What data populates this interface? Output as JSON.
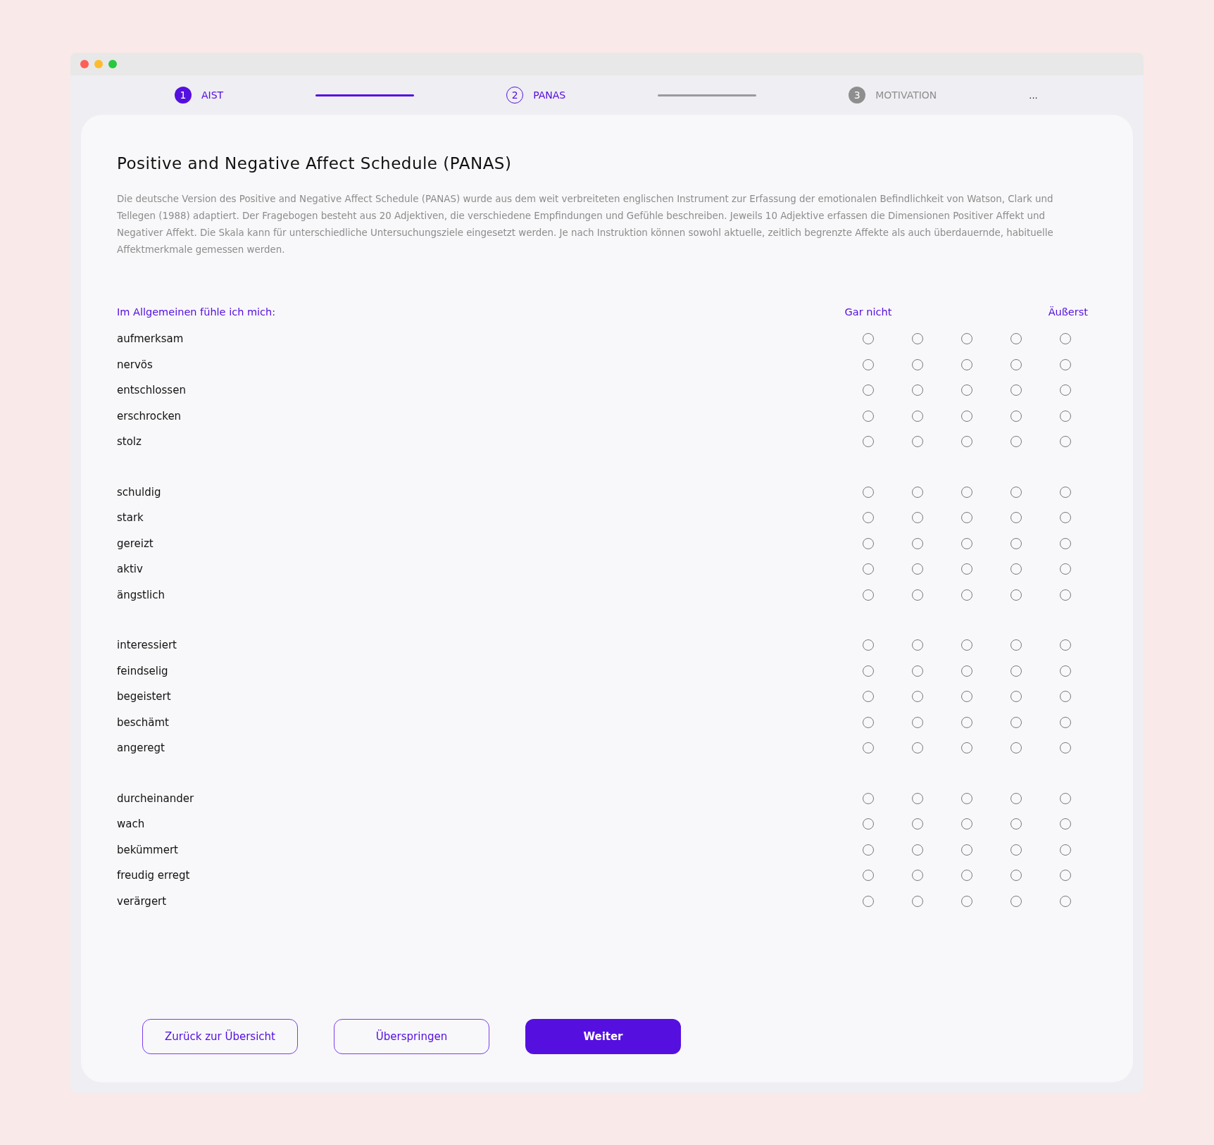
{
  "window": {
    "controls": [
      {
        "kind": "close"
      },
      {
        "kind": "minimize"
      },
      {
        "kind": "zoom"
      }
    ]
  },
  "steps": [
    {
      "number": "1",
      "label": "AIST",
      "done": true,
      "selected": false
    },
    {
      "number": "2",
      "label": "PANAS",
      "done": false,
      "selected": true
    },
    {
      "number": "3",
      "label": "MOTIVATION",
      "done": false,
      "selected": false
    }
  ],
  "more_steps": "...",
  "title": "Positive and Negative Affect Schedule (PANAS)",
  "description": "Die deutsche Version des Positive and Negative Affect Schedule (PANAS) wurde aus dem weit verbreiteten englischen Instrument zur Erfassung der emotionalen Befindlichkeit von Watson, Clark und Tellegen (1988) adaptiert. Der Fragebogen besteht aus 20 Adjektiven, die verschiedene Empfindungen und Gefühle beschreiben. Jeweils 10 Adjektive erfassen die Dimensionen Positiver Affekt und Negativer Affekt. Die Skala kann für unterschiedliche Untersuchungsziele eingesetzt werden. Je nach Instruktion können sowohl aktuelle, zeitlich begrenzte Affekte als auch überdauernde, habituelle Affektmerkmale gemessen werden.",
  "scale": {
    "prompt": "Im Allgemeinen fühle ich mich:",
    "low_label": "Gar nicht",
    "high_label": "Äußerst"
  },
  "groups": [
    {
      "items": [
        {
          "label": "aufmerksam",
          "options": [
            {
              "selected": false
            },
            {
              "selected": false
            },
            {
              "selected": false
            },
            {
              "selected": false
            },
            {
              "selected": false
            }
          ]
        },
        {
          "label": "nervös",
          "options": [
            {
              "selected": false
            },
            {
              "selected": false
            },
            {
              "selected": false
            },
            {
              "selected": false
            },
            {
              "selected": false
            }
          ]
        },
        {
          "label": "entschlossen",
          "options": [
            {
              "selected": false
            },
            {
              "selected": false
            },
            {
              "selected": false
            },
            {
              "selected": false
            },
            {
              "selected": false
            }
          ]
        },
        {
          "label": "erschrocken",
          "options": [
            {
              "selected": false
            },
            {
              "selected": false
            },
            {
              "selected": false
            },
            {
              "selected": false
            },
            {
              "selected": false
            }
          ]
        },
        {
          "label": "stolz",
          "options": [
            {
              "selected": false
            },
            {
              "selected": false
            },
            {
              "selected": false
            },
            {
              "selected": false
            },
            {
              "selected": false
            }
          ]
        }
      ]
    },
    {
      "items": [
        {
          "label": "schuldig",
          "options": [
            {
              "selected": false
            },
            {
              "selected": false
            },
            {
              "selected": false
            },
            {
              "selected": false
            },
            {
              "selected": false
            }
          ]
        },
        {
          "label": "stark",
          "options": [
            {
              "selected": false
            },
            {
              "selected": false
            },
            {
              "selected": false
            },
            {
              "selected": false
            },
            {
              "selected": false
            }
          ]
        },
        {
          "label": "gereizt",
          "options": [
            {
              "selected": false
            },
            {
              "selected": false
            },
            {
              "selected": false
            },
            {
              "selected": false
            },
            {
              "selected": false
            }
          ]
        },
        {
          "label": "aktiv",
          "options": [
            {
              "selected": false
            },
            {
              "selected": false
            },
            {
              "selected": false
            },
            {
              "selected": false
            },
            {
              "selected": false
            }
          ]
        },
        {
          "label": "ängstlich",
          "options": [
            {
              "selected": false
            },
            {
              "selected": false
            },
            {
              "selected": false
            },
            {
              "selected": false
            },
            {
              "selected": false
            }
          ]
        }
      ]
    },
    {
      "items": [
        {
          "label": "interessiert",
          "options": [
            {
              "selected": false
            },
            {
              "selected": false
            },
            {
              "selected": false
            },
            {
              "selected": false
            },
            {
              "selected": false
            }
          ]
        },
        {
          "label": "feindselig",
          "options": [
            {
              "selected": false
            },
            {
              "selected": false
            },
            {
              "selected": false
            },
            {
              "selected": false
            },
            {
              "selected": false
            }
          ]
        },
        {
          "label": "begeistert",
          "options": [
            {
              "selected": false
            },
            {
              "selected": false
            },
            {
              "selected": false
            },
            {
              "selected": false
            },
            {
              "selected": false
            }
          ]
        },
        {
          "label": "beschämt",
          "options": [
            {
              "selected": false
            },
            {
              "selected": false
            },
            {
              "selected": false
            },
            {
              "selected": false
            },
            {
              "selected": false
            }
          ]
        },
        {
          "label": "angeregt",
          "options": [
            {
              "selected": false
            },
            {
              "selected": false
            },
            {
              "selected": false
            },
            {
              "selected": false
            },
            {
              "selected": false
            }
          ]
        }
      ]
    },
    {
      "items": [
        {
          "label": "durcheinander",
          "options": [
            {
              "selected": false
            },
            {
              "selected": false
            },
            {
              "selected": false
            },
            {
              "selected": false
            },
            {
              "selected": false
            }
          ]
        },
        {
          "label": "wach",
          "options": [
            {
              "selected": false
            },
            {
              "selected": false
            },
            {
              "selected": false
            },
            {
              "selected": false
            },
            {
              "selected": false
            }
          ]
        },
        {
          "label": "bekümmert",
          "options": [
            {
              "selected": false
            },
            {
              "selected": false
            },
            {
              "selected": false
            },
            {
              "selected": false
            },
            {
              "selected": false
            }
          ]
        },
        {
          "label": "freudig erregt",
          "options": [
            {
              "selected": false
            },
            {
              "selected": false
            },
            {
              "selected": false
            },
            {
              "selected": false
            },
            {
              "selected": false
            }
          ]
        },
        {
          "label": "verärgert",
          "options": [
            {
              "selected": false
            },
            {
              "selected": false
            },
            {
              "selected": false
            },
            {
              "selected": false
            },
            {
              "selected": false
            }
          ]
        }
      ]
    }
  ],
  "buttons": [
    {
      "label": "Zurück zur Übersicht",
      "kind": "secondary"
    },
    {
      "label": "Überspringen",
      "kind": "secondary"
    },
    {
      "label": "Weiter",
      "kind": "primary"
    }
  ]
}
